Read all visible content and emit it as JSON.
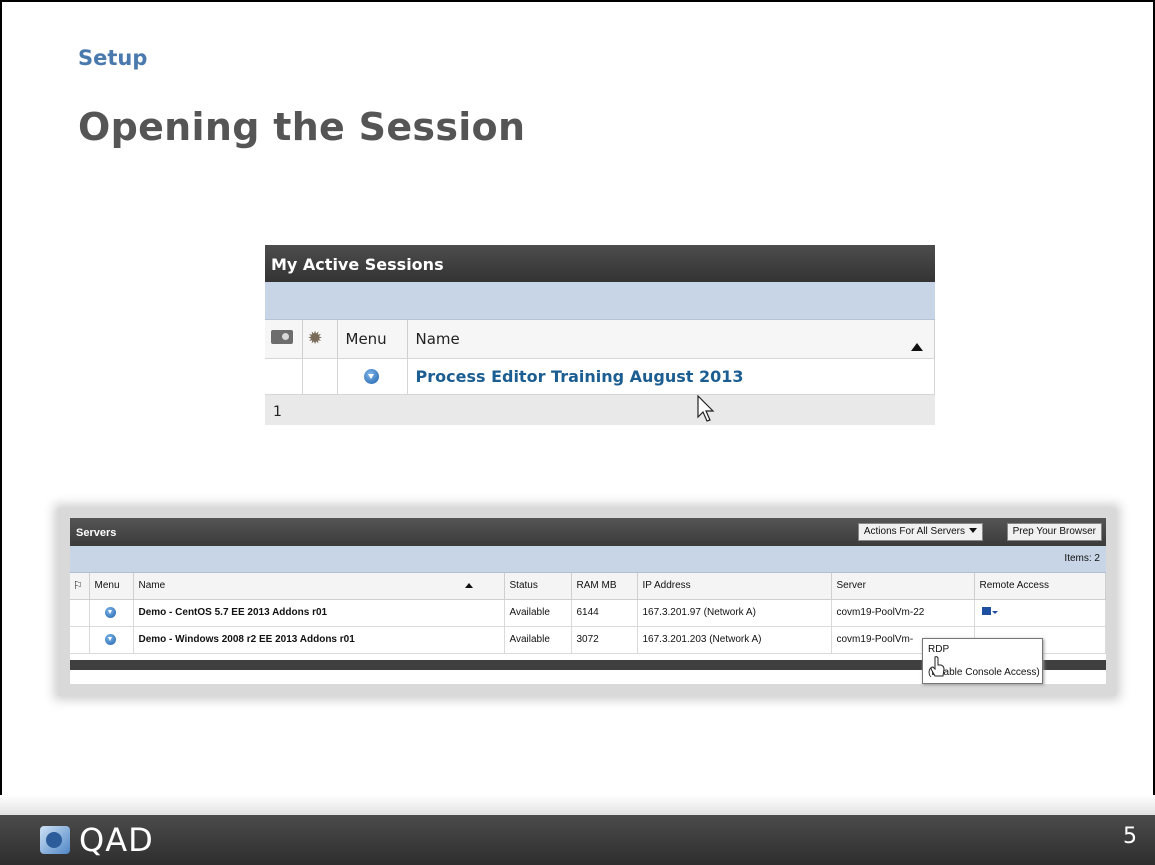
{
  "slide": {
    "section": "Setup",
    "title": "Opening the Session",
    "page_number": "5",
    "brand": "QAD"
  },
  "active_sessions": {
    "title": "My Active Sessions",
    "columns": {
      "menu": "Menu",
      "name": "Name"
    },
    "row": {
      "name": "Process Editor Training August 2013"
    },
    "footer_page": "1"
  },
  "servers": {
    "title": "Servers",
    "actions_button": "Actions For All Servers",
    "prep_button": "Prep Your Browser",
    "items": "Items: 2",
    "columns": {
      "menu": "Menu",
      "name": "Name",
      "status": "Status",
      "ram": "RAM MB",
      "ip": "IP Address",
      "server": "Server",
      "remote": "Remote Access"
    },
    "rows": [
      {
        "name": "Demo - CentOS 5.7 EE 2013 Addons r01",
        "status": "Available",
        "ram": "6144",
        "ip": "167.3.201.97 (Network A)",
        "server": "covm19-PoolVm-22"
      },
      {
        "name": "Demo - Windows 2008 r2 EE 2013 Addons r01",
        "status": "Available",
        "ram": "3072",
        "ip": "167.3.201.203 (Network A)",
        "server": "covm19-PoolVm-"
      }
    ],
    "context_menu": {
      "rdp": "RDP",
      "console": "(Enable Console Access)"
    }
  },
  "colors": {
    "section_blue": "#4a79ad",
    "title_gray": "#555555",
    "link_blue": "#1c5e91",
    "header_dark": "#3b3b3b",
    "bluebar": "#c7d5e6"
  }
}
